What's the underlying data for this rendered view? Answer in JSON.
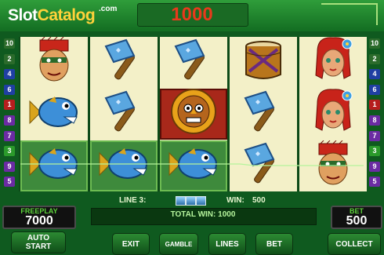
{
  "header": {
    "logo_slot": "Slot",
    "logo_catalog": "Catalog",
    "logo_com": ".com",
    "credits": "1000"
  },
  "line_indicators": {
    "left": [
      "10",
      "2",
      "4",
      "6",
      "1",
      "8",
      "7",
      "3",
      "9",
      "5"
    ],
    "right": [
      "10",
      "2",
      "4",
      "6",
      "1",
      "8",
      "7",
      "3",
      "9",
      "5"
    ]
  },
  "reels": [
    [
      "warrior-face",
      "piranha-fish",
      "piranha-fish"
    ],
    [
      "stone-hammer",
      "stone-hammer",
      "piranha-fish"
    ],
    [
      "stone-hammer",
      "tribal-mask",
      "piranha-fish"
    ],
    [
      "tribal-drum",
      "stone-hammer",
      "stone-hammer"
    ],
    [
      "flower-girl",
      "flower-girl",
      "warrior-face"
    ]
  ],
  "win_line": {
    "label": "LINE 3:",
    "win_label": "WIN:",
    "win_value": "500"
  },
  "freeplay": {
    "title": "FREEPLAY",
    "value": "7000"
  },
  "bet": {
    "title": "BET",
    "value": "500"
  },
  "total_win": "TOTAL WIN: 1000",
  "buttons": {
    "auto_start": "AUTO\nSTART",
    "exit": "EXIT",
    "gamble": "GAMBLE",
    "lines": "LINES",
    "bet": "BET",
    "collect": "COLLECT"
  },
  "colors": {
    "background": "#0f5a1f",
    "credits": "#e73a1c",
    "accent_green": "#5bd13a"
  }
}
